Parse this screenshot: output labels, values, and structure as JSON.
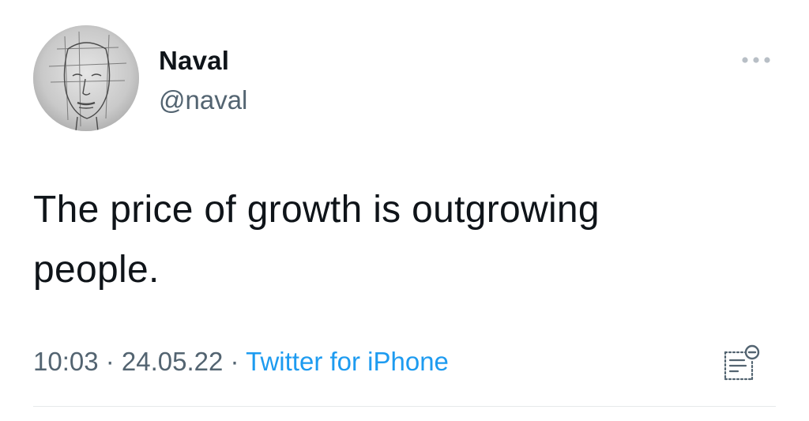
{
  "author": {
    "display_name": "Naval",
    "handle": "@naval"
  },
  "tweet": {
    "text_line1": "The price of growth is outgrowing",
    "text_line2": "people."
  },
  "meta": {
    "time": "10:03",
    "separator1": " · ",
    "date": "24.05.22",
    "separator2": " · ",
    "source": "Twitter for iPhone"
  },
  "icons": {
    "more": "more-horizontal-icon",
    "analytics": "analytics-icon",
    "avatar": "pencil-sketch-face"
  },
  "colors": {
    "text_primary": "#0f1419",
    "text_secondary": "#536471",
    "link": "#1d9bf0",
    "divider": "#e7e9ea"
  }
}
